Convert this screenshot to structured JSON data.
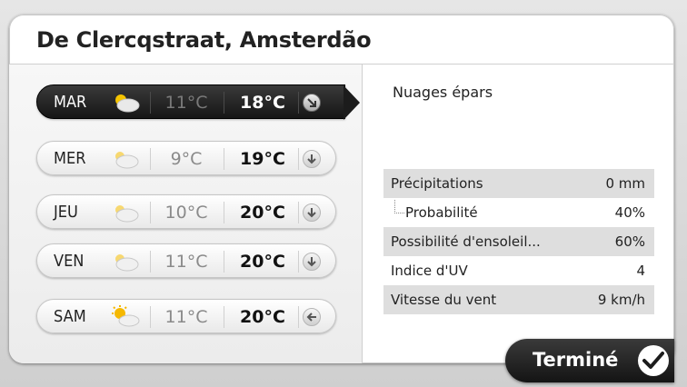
{
  "header": {
    "title": "De Clercqstraat, Amsterdão"
  },
  "forecast": [
    {
      "day": "MAR",
      "icon": "partly-cloudy-icon",
      "low": "11°C",
      "high": "18°C",
      "wind": "arrow-southeast-icon",
      "selected": true
    },
    {
      "day": "MER",
      "icon": "cloudy-icon",
      "low": "9°C",
      "high": "19°C",
      "wind": "arrow-down-icon"
    },
    {
      "day": "JEU",
      "icon": "cloudy-icon",
      "low": "10°C",
      "high": "20°C",
      "wind": "arrow-down-icon"
    },
    {
      "day": "VEN",
      "icon": "cloudy-icon",
      "low": "11°C",
      "high": "20°C",
      "wind": "arrow-down-icon"
    },
    {
      "day": "SAM",
      "icon": "sun-cloud-icon",
      "low": "11°C",
      "high": "20°C",
      "wind": "arrow-left-icon"
    }
  ],
  "details": {
    "condition": "Nuages épars",
    "rows": [
      {
        "label": "Précipitations",
        "value": "0 mm"
      },
      {
        "label": "Probabilité",
        "value": "40%"
      },
      {
        "label": "Possibilité d'ensoleil...",
        "value": "60%"
      },
      {
        "label": "Indice d'UV",
        "value": "4"
      },
      {
        "label": "Vitesse du vent",
        "value": "9 km/h"
      }
    ]
  },
  "footer": {
    "done_label": "Terminé"
  },
  "colors": {
    "dark": "#1c1c1c",
    "shade": "#dedede",
    "low_temp": "#8a8a8a"
  }
}
